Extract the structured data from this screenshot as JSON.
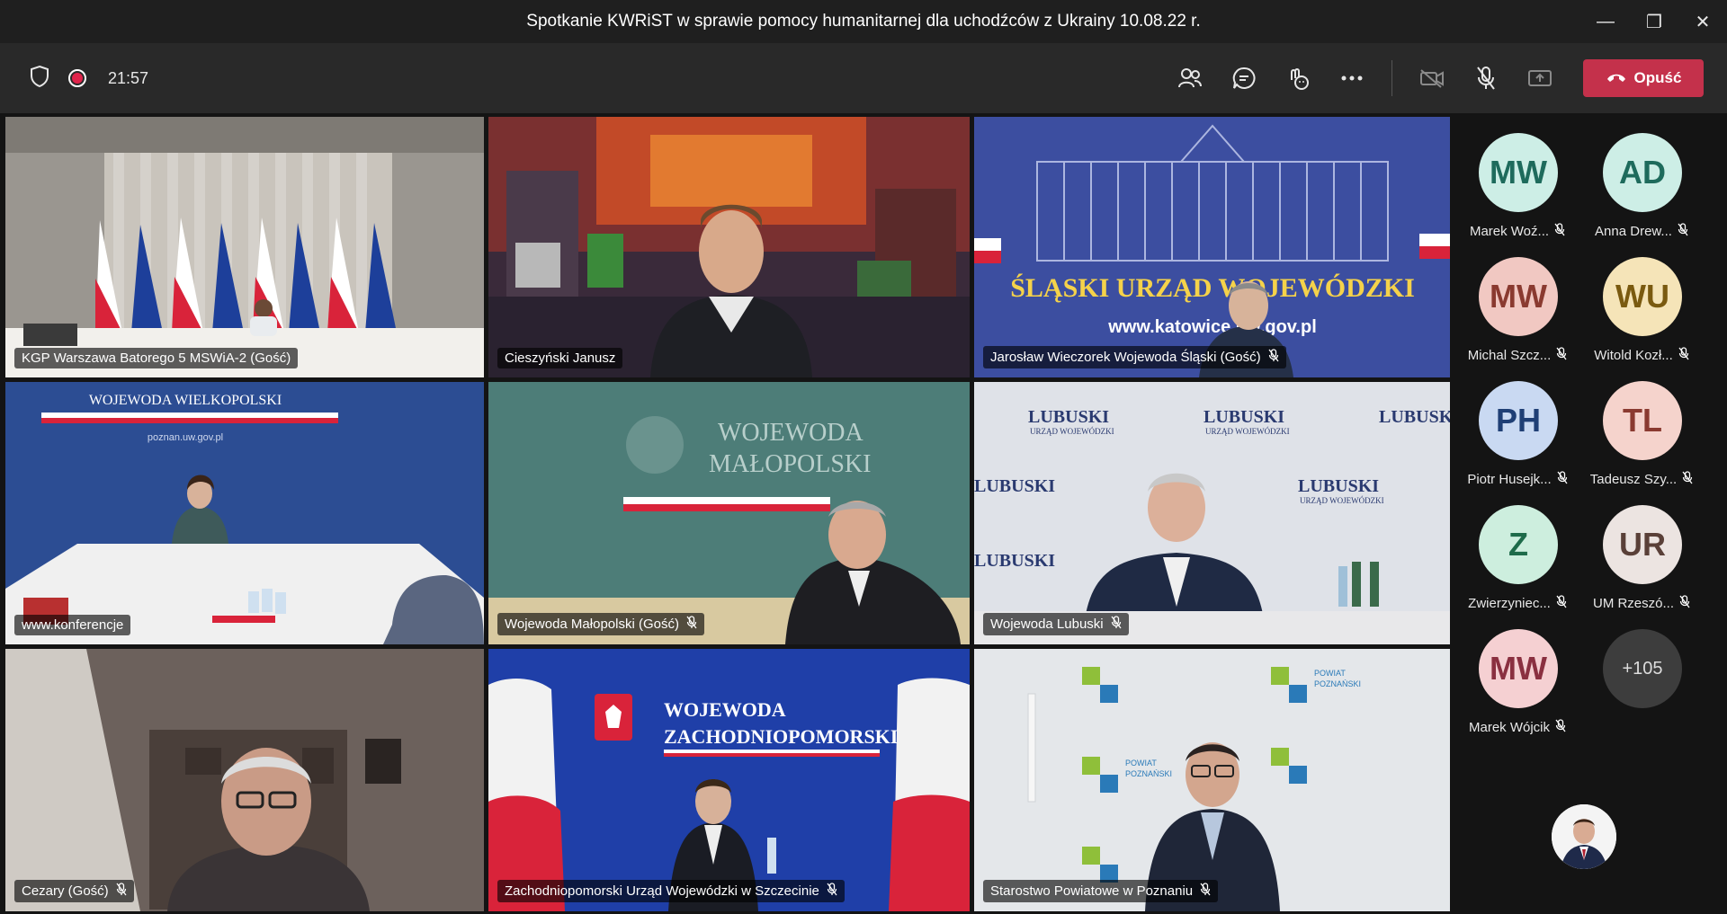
{
  "window": {
    "title": "Spotkanie KWRiST w sprawie pomocy humanitarnej dla uchodźców z Ukrainy 10.08.22 r.",
    "minimize": "—",
    "maximize": "❐",
    "close": "✕"
  },
  "toolbar": {
    "timer": "21:57",
    "leave_label": "Opuść",
    "icons": [
      "shield-icon",
      "recording-icon",
      "people-icon",
      "chat-icon",
      "reactions-icon",
      "more-icon",
      "camera-off-icon",
      "mic-off-icon",
      "share-icon",
      "phone-icon"
    ],
    "leave_color": "#c4314b"
  },
  "tiles": [
    {
      "name": "KGP Warszawa Batorego 5 MSWiA-2 (Gość)",
      "muted": false,
      "active": true
    },
    {
      "name": "Cieszyński Janusz",
      "muted": false,
      "active": true
    },
    {
      "name": "Jarosław Wieczorek Wojewoda Śląski (Gość)",
      "muted": true,
      "active": false
    },
    {
      "name": "www.konferencje",
      "muted": false,
      "active": false
    },
    {
      "name": "Wojewoda Małopolski (Gość)",
      "muted": true,
      "active": false
    },
    {
      "name": "Wojewoda Lubuski",
      "muted": true,
      "active": false
    },
    {
      "name": "Cezary (Gość)",
      "muted": true,
      "active": false
    },
    {
      "name": "Zachodniopomorski Urząd Wojewódzki w Szczecinie",
      "muted": true,
      "active": false
    },
    {
      "name": "Starostwo Powiatowe w Poznaniu",
      "muted": true,
      "active": false
    }
  ],
  "scene_text": {
    "slaski": "ŚLĄSKI URZĄD WOJEWÓDZKI",
    "katowice": "www.katowice.uw.gov.pl",
    "wielkopolski": "WOJEWODA WIELKOPOLSKI",
    "poznan_url": "poznan.uw.gov.pl",
    "malopolski_1": "WOJEWODA",
    "malopolski_2": "MAŁOPOLSKI",
    "lubuski": "LUBUSKI",
    "lubuski_sub": "URZĄD WOJEWÓDZKI",
    "zachodnio_1": "WOJEWODA",
    "zachodnio_2": "ZACHODNIOPOMORSKI",
    "powiat_1": "POWIAT",
    "powiat_2": "POZNAŃSKI"
  },
  "roster": [
    {
      "initials": "MW",
      "name": "Marek Woź...",
      "bg": "#cdeee6",
      "fg": "#1e6b5c"
    },
    {
      "initials": "AD",
      "name": "Anna Drew...",
      "bg": "#cdeee6",
      "fg": "#1e6b5c"
    },
    {
      "initials": "MW",
      "name": "Michal Szcz...",
      "bg": "#f1c8c2",
      "fg": "#8a3a30"
    },
    {
      "initials": "WU",
      "name": "Witold Kozł...",
      "bg": "#f5e4b8",
      "fg": "#7a5a10"
    },
    {
      "initials": "PH",
      "name": "Piotr Husejk...",
      "bg": "#c9d9f2",
      "fg": "#1f3f75"
    },
    {
      "initials": "TL",
      "name": "Tadeusz Szy...",
      "bg": "#f5d3cc",
      "fg": "#8a3a30"
    },
    {
      "initials": "Z",
      "name": "Zwierzyniec...",
      "bg": "#cdeede",
      "fg": "#1e6b4a"
    },
    {
      "initials": "UR",
      "name": "UM Rzeszó...",
      "bg": "#ece4e1",
      "fg": "#5a4038"
    },
    {
      "initials": "MW",
      "name": "Marek Wójcik",
      "bg": "#f5d0d2",
      "fg": "#8a3040"
    }
  ],
  "overflow_count": "+105"
}
